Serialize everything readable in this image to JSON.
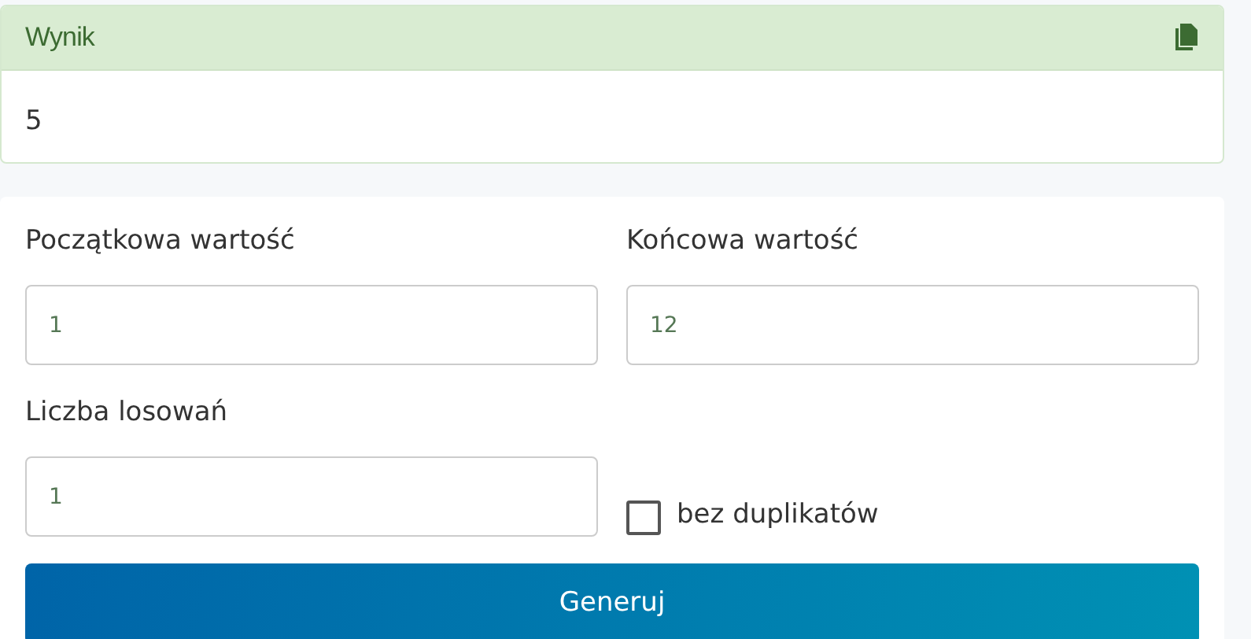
{
  "result": {
    "title": "Wynik",
    "value": "5"
  },
  "form": {
    "fields": [
      {
        "label": "Początkowa wartość",
        "value": "1"
      },
      {
        "label": "Końcowa wartość",
        "value": "12"
      },
      {
        "label": "Liczba losowań",
        "value": "1"
      }
    ],
    "checkbox": {
      "label": "bez duplikatów",
      "checked": false
    },
    "button": "Generuj"
  }
}
